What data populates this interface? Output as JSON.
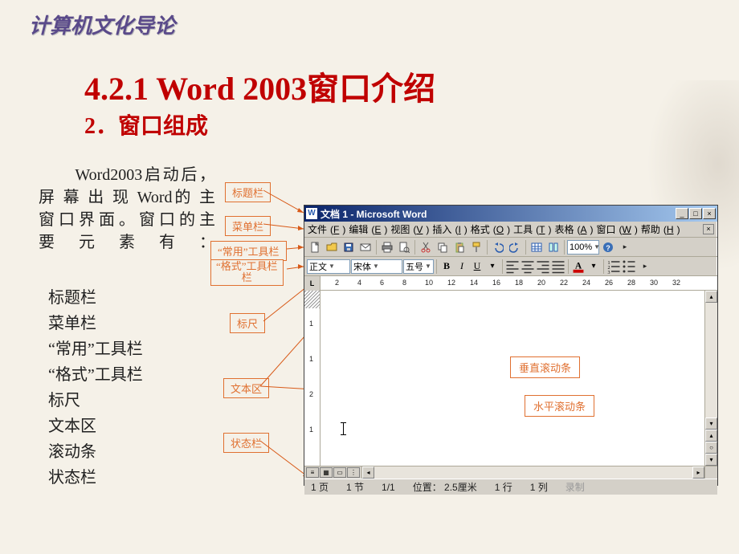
{
  "page_title": "计算机文化导论",
  "main_heading": "4.2.1  Word 2003窗口介绍",
  "sub_heading": "2．窗口组成",
  "intro_lines": [
    "　　Word2003启动后，",
    "屏 幕 出 现 Word的 主",
    "窗口界面。窗口的主",
    "要元素有："
  ],
  "elements": [
    "标题栏",
    "菜单栏",
    "“常用”工具栏",
    "“格式”工具栏",
    "标尺",
    "文本区",
    "滚动条",
    "状态栏"
  ],
  "labels": {
    "title_bar": "标题栏",
    "menu_bar": "菜单栏",
    "standard_toolbar": "“常用”工具栏",
    "format_toolbar_line1": "“格式”工具栏",
    "format_toolbar_line2": "栏",
    "ruler": "标尺",
    "text_area": "文本区",
    "status_bar": "状态栏",
    "v_scroll": "垂直滚动条",
    "h_scroll": "水平滚动条"
  },
  "word": {
    "title_icon": "W",
    "title": "文档 1 - Microsoft Word",
    "win_controls": {
      "min": "_",
      "max": "□",
      "close": "×"
    },
    "menus": [
      {
        "label": "文件",
        "mn": "F"
      },
      {
        "label": "编辑",
        "mn": "E"
      },
      {
        "label": "视图",
        "mn": "V"
      },
      {
        "label": "插入",
        "mn": "I"
      },
      {
        "label": "格式",
        "mn": "O"
      },
      {
        "label": "工具",
        "mn": "T"
      },
      {
        "label": "表格",
        "mn": "A"
      },
      {
        "label": "窗口",
        "mn": "W"
      },
      {
        "label": "帮助",
        "mn": "H"
      }
    ],
    "doc_close": "×",
    "standard_toolbar": {
      "zoom": "100%"
    },
    "format_toolbar": {
      "style": "正文",
      "font": "宋体",
      "size": "五号",
      "bold": "B",
      "italic": "I",
      "underline": "U"
    },
    "ruler_corner": "L",
    "h_ruler_ticks": [
      "2",
      "4",
      "6",
      "8",
      "10",
      "12",
      "14",
      "16",
      "18",
      "20",
      "22",
      "24",
      "26",
      "28",
      "30",
      "32"
    ],
    "v_ruler_ticks": [
      "1",
      "1",
      "2",
      "1"
    ],
    "status": {
      "page": "1 页",
      "section": "1 节",
      "page_of": "1/1",
      "position": "位置： 2.5厘米",
      "line": "1 行",
      "col": "1 列",
      "mode": "录制"
    }
  }
}
